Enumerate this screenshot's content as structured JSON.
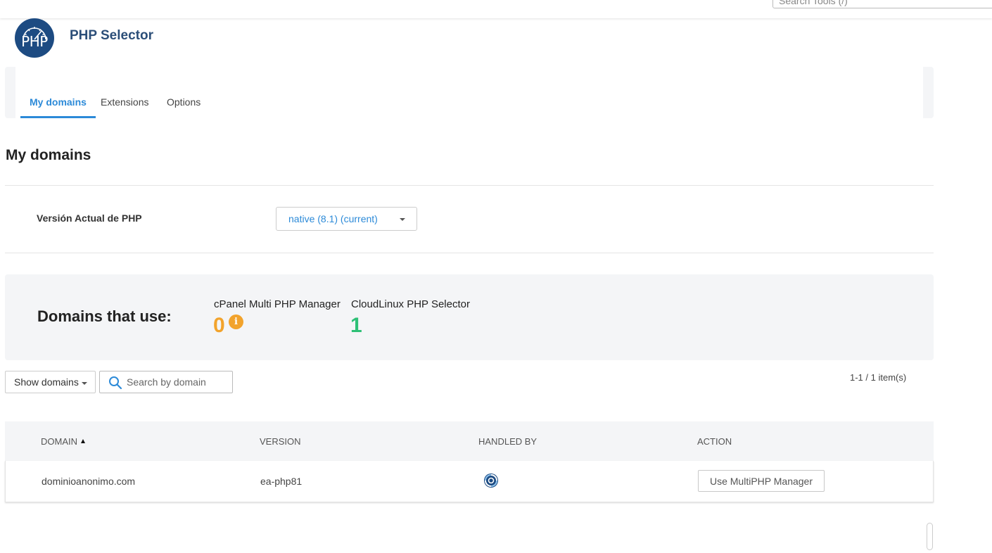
{
  "topbar": {
    "search_placeholder": "Search Tools (/)"
  },
  "app": {
    "logo_text": "PHP",
    "title": "PHP Selector"
  },
  "tabs": [
    {
      "label": "My domains",
      "active": true
    },
    {
      "label": "Extensions",
      "active": false
    },
    {
      "label": "Options",
      "active": false
    }
  ],
  "section": {
    "title": "My domains"
  },
  "php_version": {
    "label": "Versión Actual de PHP",
    "selected": "native (8.1) (current)"
  },
  "stats": {
    "heading": "Domains that use:",
    "items": [
      {
        "label": "cPanel Multi PHP Manager",
        "value": "0",
        "color": "#f2a32c",
        "info_icon": "info-icon"
      },
      {
        "label": "CloudLinux PHP Selector",
        "value": "1",
        "color": "#2ec076"
      }
    ]
  },
  "filters": {
    "show_domains_label": "Show domains",
    "search_placeholder": "Search by domain",
    "pagination": "1-1 / 1 item(s)"
  },
  "table": {
    "columns": [
      "DOMAIN",
      "VERSION",
      "HANDLED BY",
      "ACTION"
    ],
    "sort": {
      "column": "DOMAIN",
      "direction": "asc"
    },
    "rows": [
      {
        "domain": "dominioanonimo.com",
        "version": "ea-php81",
        "handled_by_icon": "cpanel-multiphp-icon",
        "action_label": "Use MultiPHP Manager"
      }
    ]
  },
  "colors": {
    "accent": "#2c8ad8",
    "title": "#2b4e78",
    "logo_bg": "#1d4b82",
    "warning": "#f2a32c",
    "success": "#2ec076"
  }
}
